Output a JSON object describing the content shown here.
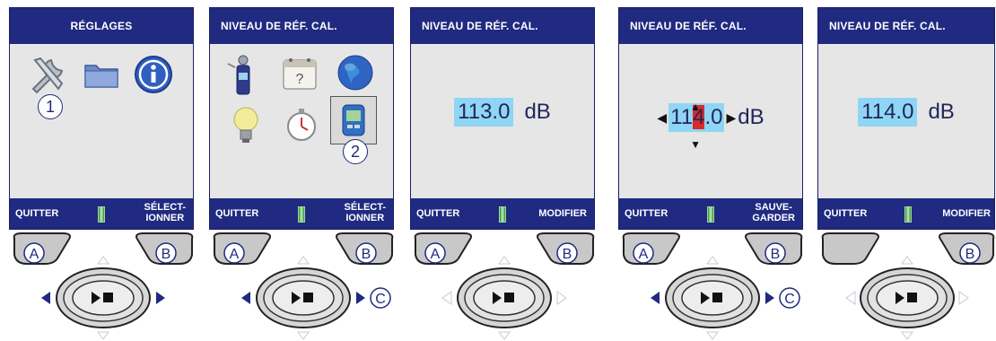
{
  "panels": [
    {
      "title": "RÉGLAGES",
      "icons": [
        "wrench-icon",
        "folder-icon",
        "info-icon"
      ],
      "marker": "1",
      "footer": {
        "left": "QUITTER",
        "right_line1": "SÉLECT-",
        "right_line2": "IONNER"
      },
      "keys": {
        "a": "A",
        "b": "B"
      }
    },
    {
      "title": "NIVEAU DE RÉF. CAL.",
      "icons": [
        "meter-icon",
        "calendar-icon",
        "globe-icon",
        "lightbulb-icon",
        "stopwatch-icon",
        "calibrator-icon"
      ],
      "marker": "2",
      "footer": {
        "left": "QUITTER",
        "right_line1": "SÉLECT-",
        "right_line2": "IONNER"
      },
      "keys": {
        "a": "A",
        "b": "B",
        "c": "C"
      }
    },
    {
      "title": "NIVEAU DE RÉF. CAL.",
      "value": "113.0",
      "unit": "dB",
      "footer": {
        "left": "QUITTER",
        "right": "MODIFIER"
      },
      "keys": {
        "a": "A",
        "b": "B"
      }
    },
    {
      "title": "NIVEAU DE RÉF. CAL.",
      "value_pre": "11",
      "value_digit": "4",
      "value_post": ".0",
      "unit": "dB",
      "footer": {
        "left": "QUITTER",
        "right_line1": "SAUVE-",
        "right_line2": "GARDER"
      },
      "keys": {
        "a": "A",
        "b": "B",
        "c": "C"
      }
    },
    {
      "title": "NIVEAU DE RÉF. CAL.",
      "value": "114.0",
      "unit": "dB",
      "footer": {
        "left": "QUITTER",
        "right": "MODIFIER"
      },
      "keys": {
        "b": "B"
      }
    }
  ],
  "colors": {
    "header": "#1f2a80",
    "value_highlight": "#8fd6f4",
    "edit_digit": "#d92a2a",
    "arrow_active": "#1f2a80",
    "arrow_inactive": "#c8c8d8"
  }
}
